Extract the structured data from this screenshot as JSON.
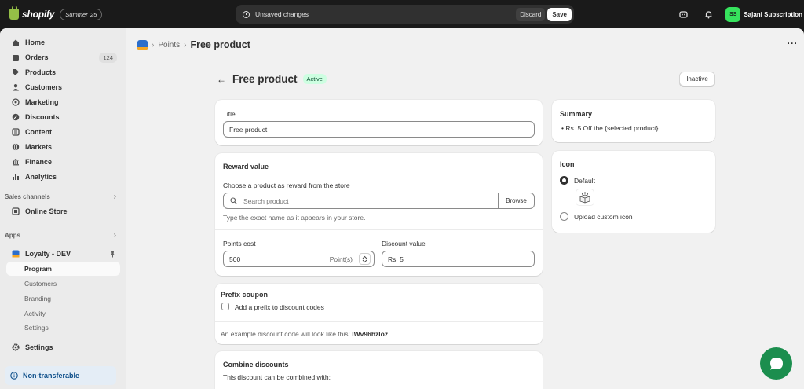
{
  "topbar": {
    "brand": "shopify",
    "edition": "Summer '25",
    "unsaved_text": "Unsaved changes",
    "discard_label": "Discard",
    "save_label": "Save",
    "avatar_initials": "SS",
    "store_name": "Sajani Subscription"
  },
  "sidebar": {
    "items": [
      {
        "label": "Home",
        "icon": "home-icon"
      },
      {
        "label": "Orders",
        "icon": "orders-icon",
        "badge": "124"
      },
      {
        "label": "Products",
        "icon": "tag-icon"
      },
      {
        "label": "Customers",
        "icon": "person-icon"
      },
      {
        "label": "Marketing",
        "icon": "target-icon"
      },
      {
        "label": "Discounts",
        "icon": "discount-icon"
      },
      {
        "label": "Content",
        "icon": "content-icon"
      },
      {
        "label": "Markets",
        "icon": "globe-icon"
      },
      {
        "label": "Finance",
        "icon": "bank-icon"
      },
      {
        "label": "Analytics",
        "icon": "chart-icon"
      }
    ],
    "sales_channels_label": "Sales channels",
    "online_store_label": "Online Store",
    "apps_label": "Apps",
    "app_name": "Loyalty - DEV",
    "app_subitems": {
      "program": "Program",
      "customers": "Customers",
      "branding": "Branding",
      "activity": "Activity",
      "settings": "Settings"
    },
    "settings_label": "Settings",
    "banner_label": "Non-transferable"
  },
  "breadcrumb": {
    "parent": "Points",
    "current": "Free product"
  },
  "page": {
    "title": "Free product",
    "status": "Active",
    "inactive_button": "Inactive"
  },
  "title_card": {
    "label": "Title",
    "value": "Free product"
  },
  "reward_card": {
    "title": "Reward value",
    "choose_label": "Choose a product as reward from the store",
    "search_placeholder": "Search product",
    "browse_label": "Browse",
    "help": "Type the exact name as it appears in your store.",
    "points_cost_label": "Points cost",
    "points_cost_value": "500",
    "points_suffix": "Point(s)",
    "discount_value_label": "Discount value",
    "discount_value": "Rs. 5"
  },
  "prefix_card": {
    "title": "Prefix coupon",
    "checkbox_label": "Add a prefix to discount codes",
    "example_text": "An example discount code will look like this:",
    "example_code": "IWv96hzloz"
  },
  "combine_card": {
    "title": "Combine discounts",
    "subtitle": "This discount can be combined with:"
  },
  "summary_card": {
    "title": "Summary",
    "item": "Rs. 5 Off the {selected product}"
  },
  "icon_card": {
    "title": "Icon",
    "default_label": "Default",
    "upload_label": "Upload custom icon"
  },
  "colors": {
    "accent_green": "#36e35d",
    "active_badge": "#cdfee1",
    "chat": "#1b8e4e"
  }
}
